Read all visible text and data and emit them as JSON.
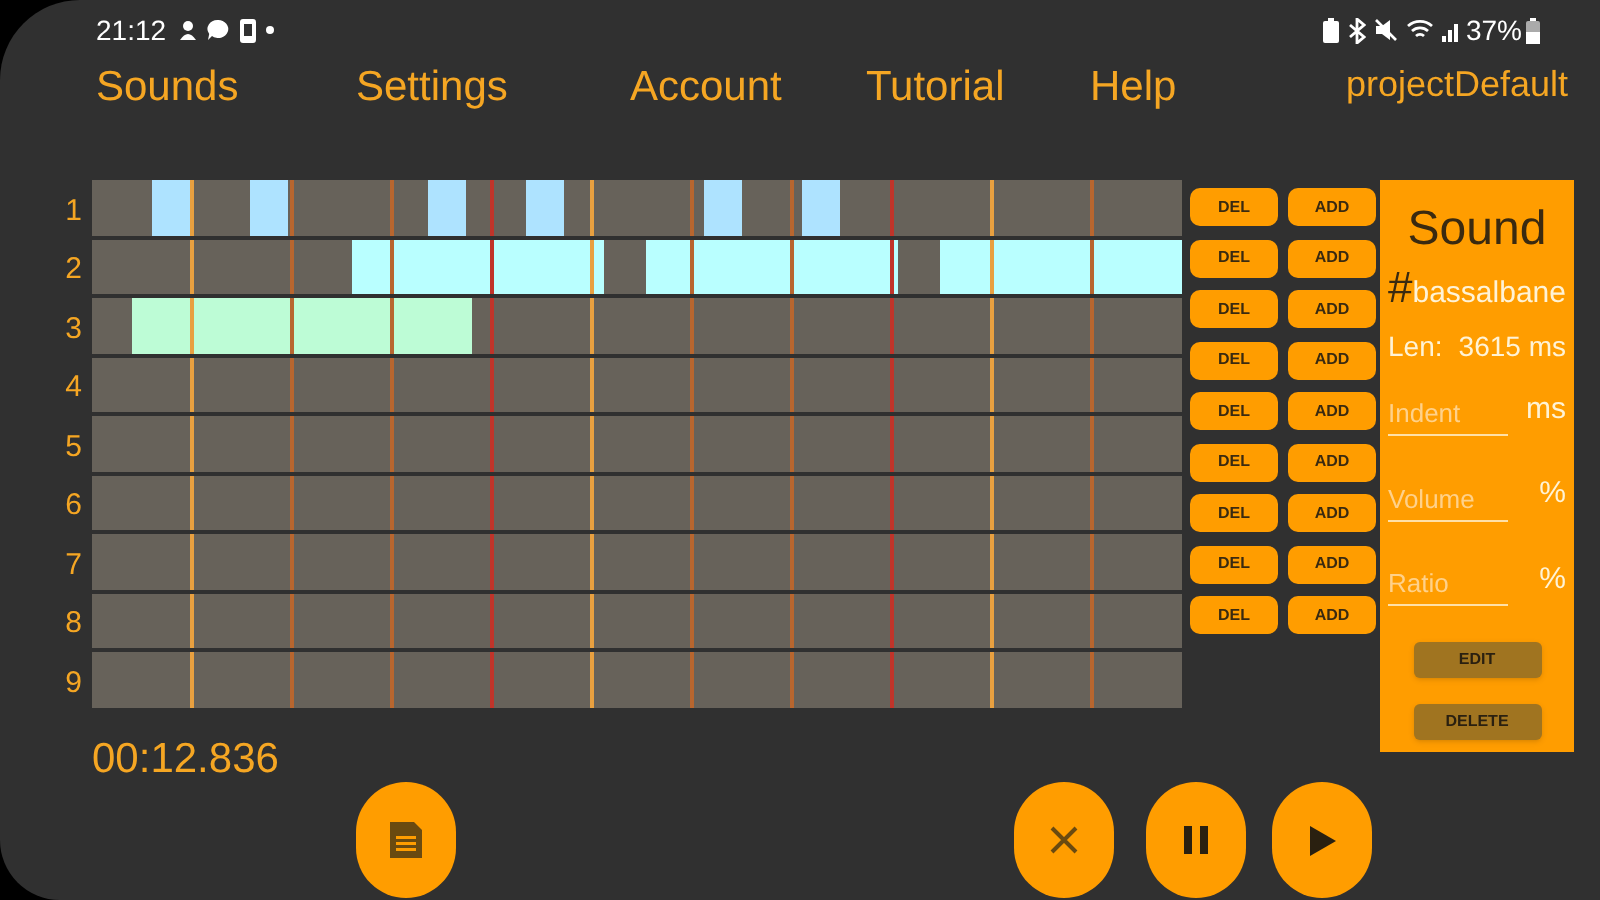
{
  "status_bar": {
    "time": "21:12",
    "battery": "37%"
  },
  "menu": [
    {
      "label": "Sounds"
    },
    {
      "label": "Settings"
    },
    {
      "label": "Account"
    },
    {
      "label": "Tutorial"
    },
    {
      "label": "Help"
    }
  ],
  "project": "projectDefault",
  "tracks": [
    {
      "label": "1",
      "color": "#aee3ff",
      "delete": "DEL",
      "add": "ADD"
    },
    {
      "label": "2",
      "color": "#b9ffff",
      "delete": "DEL",
      "add": "ADD"
    },
    {
      "label": "3",
      "color": "#bdfcd6",
      "delete": "DEL",
      "add": "ADD"
    },
    {
      "label": "4",
      "delete": "DEL",
      "add": "ADD"
    },
    {
      "label": "5",
      "delete": "DEL",
      "add": "ADD"
    },
    {
      "label": "6",
      "delete": "DEL",
      "add": "ADD"
    },
    {
      "label": "7",
      "delete": "DEL",
      "add": "ADD"
    },
    {
      "label": "8",
      "delete": "DEL",
      "add": "ADD"
    },
    {
      "label": "9",
      "delete": "DEL",
      "add": "ADD"
    }
  ],
  "sound_panel": {
    "title": "Sound",
    "hash": "#",
    "name": "bassalbane",
    "len_label": "Len:",
    "len_value": "3615 ms",
    "fields": [
      {
        "placeholder": "Indent",
        "unit": "ms"
      },
      {
        "placeholder": "Volume",
        "unit": "%"
      },
      {
        "placeholder": "Ratio",
        "unit": "%"
      }
    ],
    "buttons": [
      "EDIT",
      "DELETE"
    ]
  },
  "timer": "00:12.836"
}
